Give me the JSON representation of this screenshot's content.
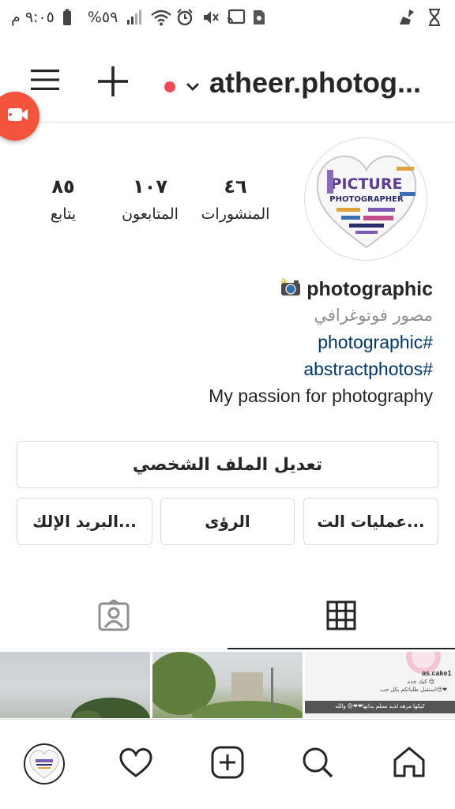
{
  "status_bar": {
    "time": "٩:٠٥ م",
    "battery": "%٥٩"
  },
  "header": {
    "username": "atheer.photog...",
    "menu_icon": "hamburger-menu-icon",
    "add_icon": "plus-icon",
    "switch_icon": "chevron-down-icon",
    "live_dot_color": "#ed4956"
  },
  "profile": {
    "avatar_text": {
      "title": "PICTURE",
      "subtitle": "PHOTOGRAPHER"
    },
    "stats": {
      "posts": {
        "value": "٤٦",
        "label": "المنشورات"
      },
      "followers": {
        "value": "١٠٧",
        "label": "المتابعون"
      },
      "following": {
        "value": "٨٥",
        "label": "يتابع"
      }
    },
    "bio": {
      "name": "photographic",
      "category": "مصور فوتوغرافي",
      "tags": [
        "photographic#",
        "abstractphotos#"
      ],
      "text": "My passion for photography"
    }
  },
  "buttons": {
    "edit_profile": "تعديل الملف الشخصي",
    "actions": "عمليات الت...",
    "insights": "الرؤى",
    "email": "البريد الإلك..."
  },
  "tabs": {
    "grid_icon": "grid-icon",
    "tagged_icon": "tagged-person-icon"
  },
  "posts_grid": {
    "chat_post": {
      "name": "as.cake1",
      "line1": "كيك جده 😋",
      "line2": "استقبل طلباتكم بكل حب😍❤",
      "caption": "كيكها مرهه لذيذ تسلم يداتها❤❤😍 والله"
    }
  },
  "bottom_nav": [
    "profile-avatar",
    "heart-icon",
    "add-post-icon",
    "search-icon",
    "home-icon"
  ],
  "colors": {
    "accent_blue": "#00376b",
    "record_button": "#f4543b",
    "text": "#262626",
    "muted": "#8e8e8e"
  }
}
